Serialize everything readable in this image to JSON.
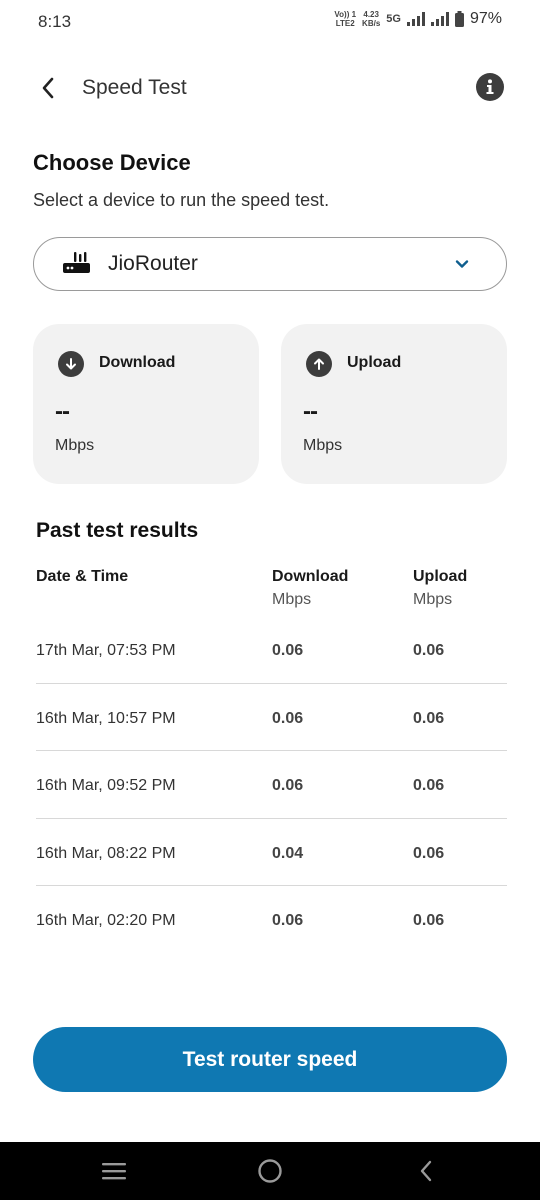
{
  "status_bar": {
    "time": "8:13",
    "volte_top": "Vo)) 1",
    "volte_bottom": "LTE2",
    "speed_top": "4.23",
    "speed_bottom": "KB/s",
    "network": "5G",
    "battery": "97%"
  },
  "app_bar": {
    "title": "Speed Test",
    "back_icon": "back-arrow-icon",
    "info_icon": "info-icon"
  },
  "choose_device": {
    "title": "Choose Device",
    "subtitle": "Select a device to run the speed test.",
    "selected_device": "JioRouter"
  },
  "cards": {
    "download": {
      "label": "Download",
      "value": "--",
      "unit": "Mbps"
    },
    "upload": {
      "label": "Upload",
      "value": "--",
      "unit": "Mbps"
    }
  },
  "past_results": {
    "title": "Past test results",
    "headers": {
      "date": "Date & Time",
      "download": "Download",
      "download_unit": "Mbps",
      "upload": "Upload",
      "upload_unit": "Mbps"
    },
    "rows": [
      {
        "date": "17th Mar, 07:53 PM",
        "download": "0.06",
        "upload": "0.06"
      },
      {
        "date": "16th Mar, 10:57 PM",
        "download": "0.06",
        "upload": "0.06"
      },
      {
        "date": "16th Mar, 09:52 PM",
        "download": "0.06",
        "upload": "0.06"
      },
      {
        "date": "16th Mar, 08:22 PM",
        "download": "0.04",
        "upload": "0.06"
      },
      {
        "date": "16th Mar, 02:20 PM",
        "download": "0.06",
        "upload": "0.06"
      }
    ]
  },
  "cta": {
    "label": "Test router speed"
  },
  "colors": {
    "accent": "#0f78b2",
    "card_bg": "#f2f2f2",
    "chevron": "#0f5f8f"
  }
}
